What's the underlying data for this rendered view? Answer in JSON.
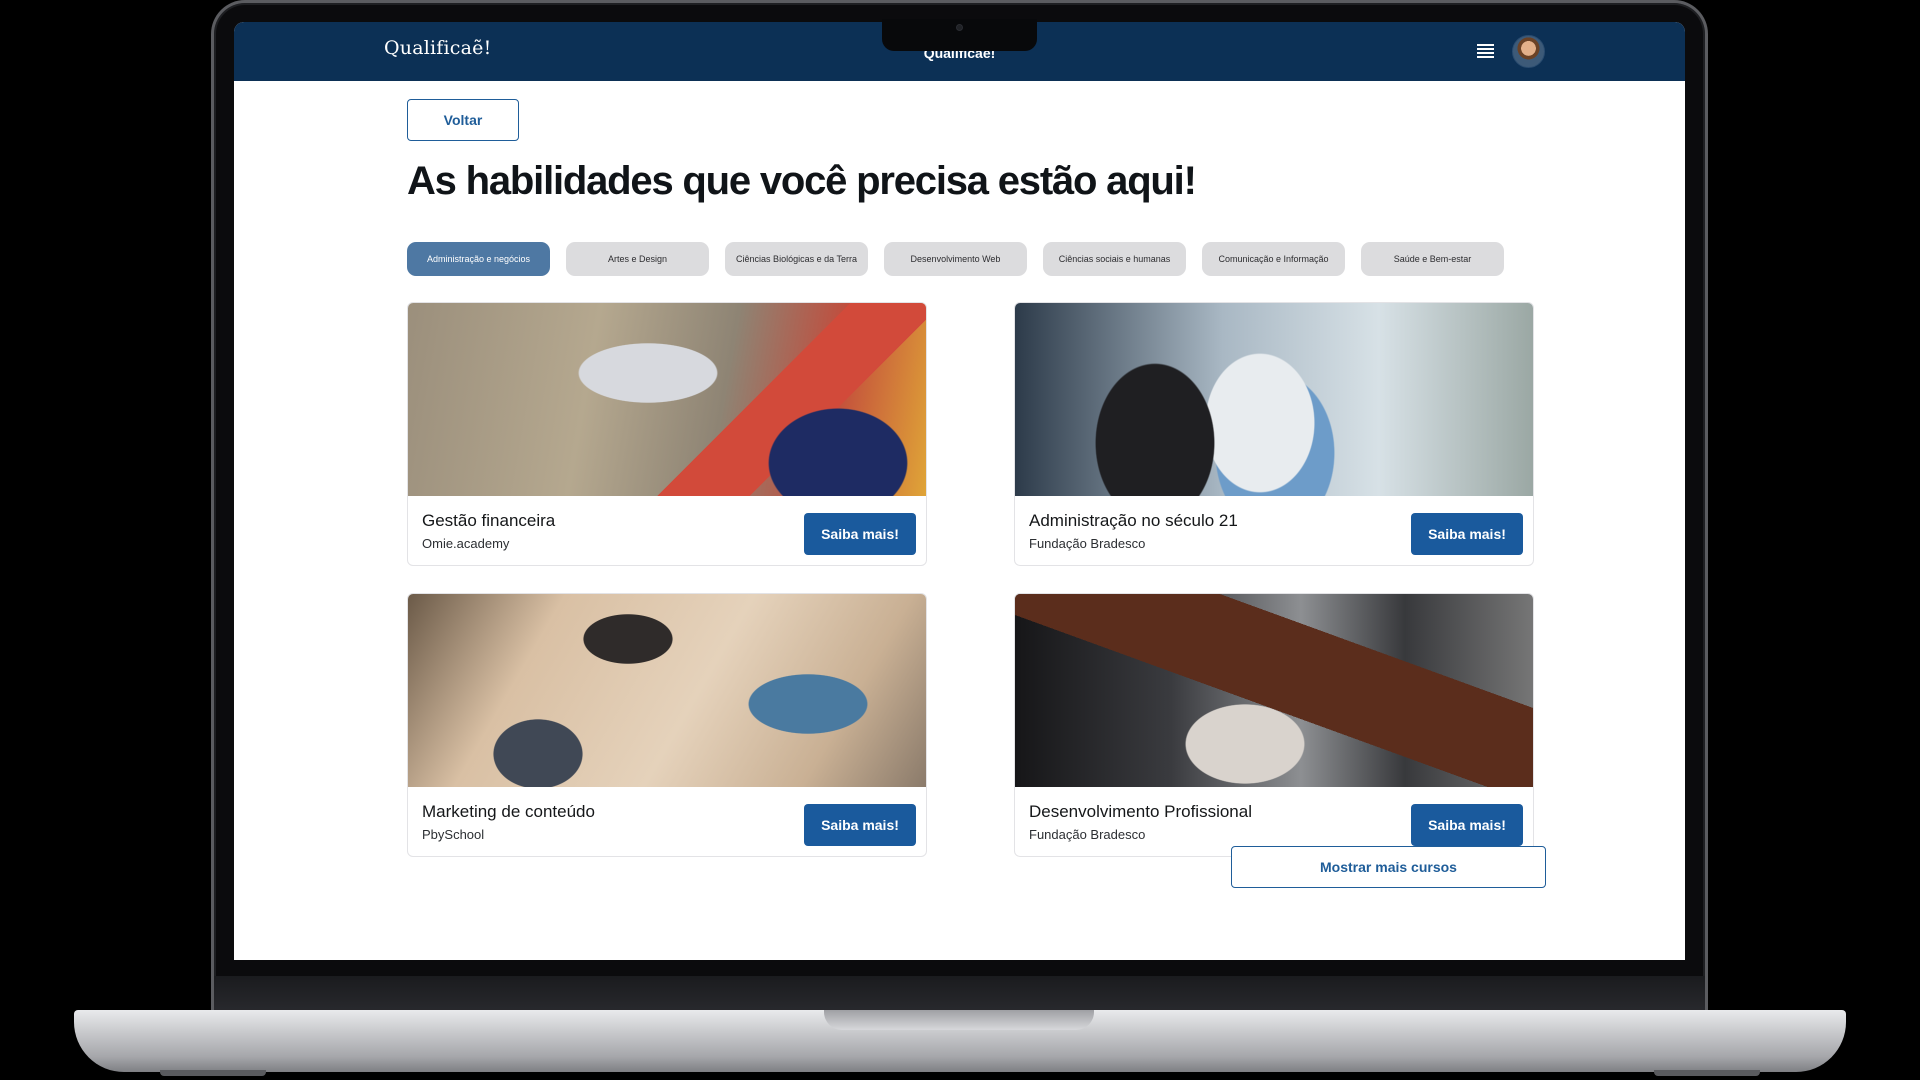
{
  "header": {
    "logo_text": "Qualificaẽ!",
    "center_title": "Qualificae!"
  },
  "page": {
    "back_label": "Voltar",
    "headline": "As habilidades que você precisa estão aqui!",
    "more_label": "Mostrar mais cursos"
  },
  "categories": [
    {
      "label": "Administração e negócios",
      "active": true
    },
    {
      "label": "Artes e Design",
      "active": false
    },
    {
      "label": "Ciências Biológicas e da Terra",
      "active": false
    },
    {
      "label": "Desenvolvimento Web",
      "active": false
    },
    {
      "label": "Ciências sociais e humanas",
      "active": false
    },
    {
      "label": "Comunicação e Informação",
      "active": false
    },
    {
      "label": "Saúde e Bem-estar",
      "active": false
    }
  ],
  "courses": [
    {
      "title": "Gestão financeira",
      "provider": "Omie.academy",
      "cta": "Saiba mais!"
    },
    {
      "title": "Administração no século 21",
      "provider": "Fundação Bradesco",
      "cta": "Saiba mais!"
    },
    {
      "title": "Marketing de conteúdo",
      "provider": "PbySchool",
      "cta": "Saiba mais!"
    },
    {
      "title": "Desenvolvimento Profissional",
      "provider": "Fundação Bradesco",
      "cta": "Saiba mais!"
    }
  ],
  "colors": {
    "topbar": "#0c3055",
    "primary": "#1a5a9d",
    "chip_active": "#4e78a3",
    "chip_inactive": "#dcdcde"
  },
  "icons": {
    "menu": "hamburger-menu-icon",
    "avatar": "user-avatar"
  }
}
